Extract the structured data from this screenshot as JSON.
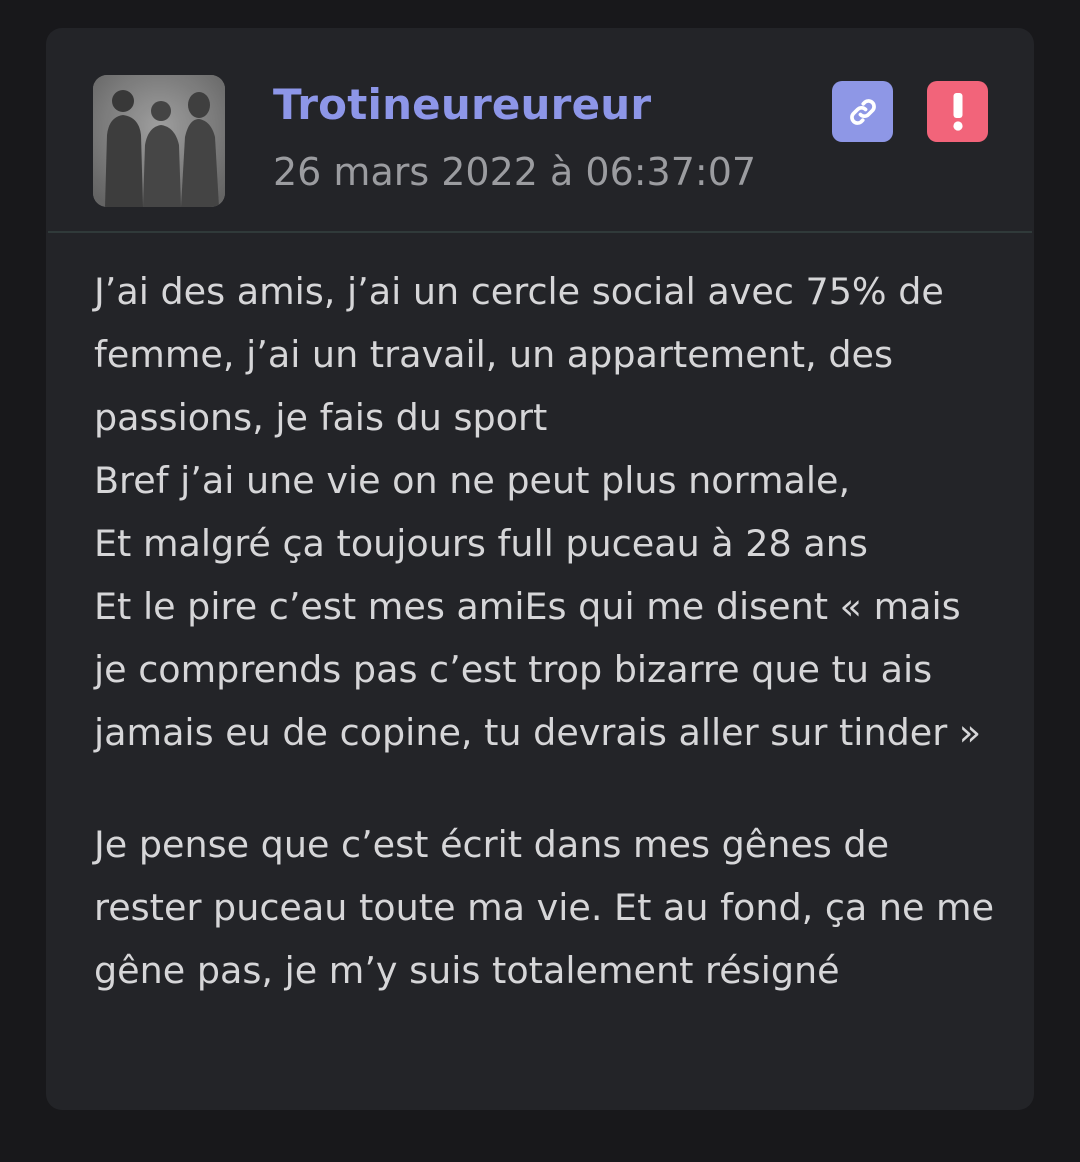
{
  "post": {
    "author": "Trotineureureur",
    "timestamp": "26 mars 2022 à 06:37:07",
    "avatar": "three-silhouettes-photo",
    "actions": {
      "link": {
        "icon": "link-icon",
        "color": "#8e97e6"
      },
      "report": {
        "icon": "exclamation-icon",
        "color": "#f2647a"
      }
    },
    "paragraphs": [
      "J’ai des amis, j’ai un cercle social avec 75% de femme, j’ai un travail, un appartement, des passions, je fais du sport\nBref j’ai une vie on ne peut plus normale,\nEt malgré ça toujours full puceau à 28 ans\nEt le pire c’est mes amiEs qui me disent « mais je comprends pas c’est trop bizarre que tu ais jamais eu de copine, tu devrais aller sur tinder »",
      "Je pense que c’est écrit dans mes gênes de rester puceau toute ma vie. Et au fond, ça ne me gêne pas, je m’y suis totalement résigné"
    ]
  },
  "colors": {
    "page_background": "#18181b",
    "card_background": "#232428",
    "author_color": "#8d96e8",
    "timestamp_color": "#9b9ca0",
    "text_color": "#d6d6d8"
  }
}
